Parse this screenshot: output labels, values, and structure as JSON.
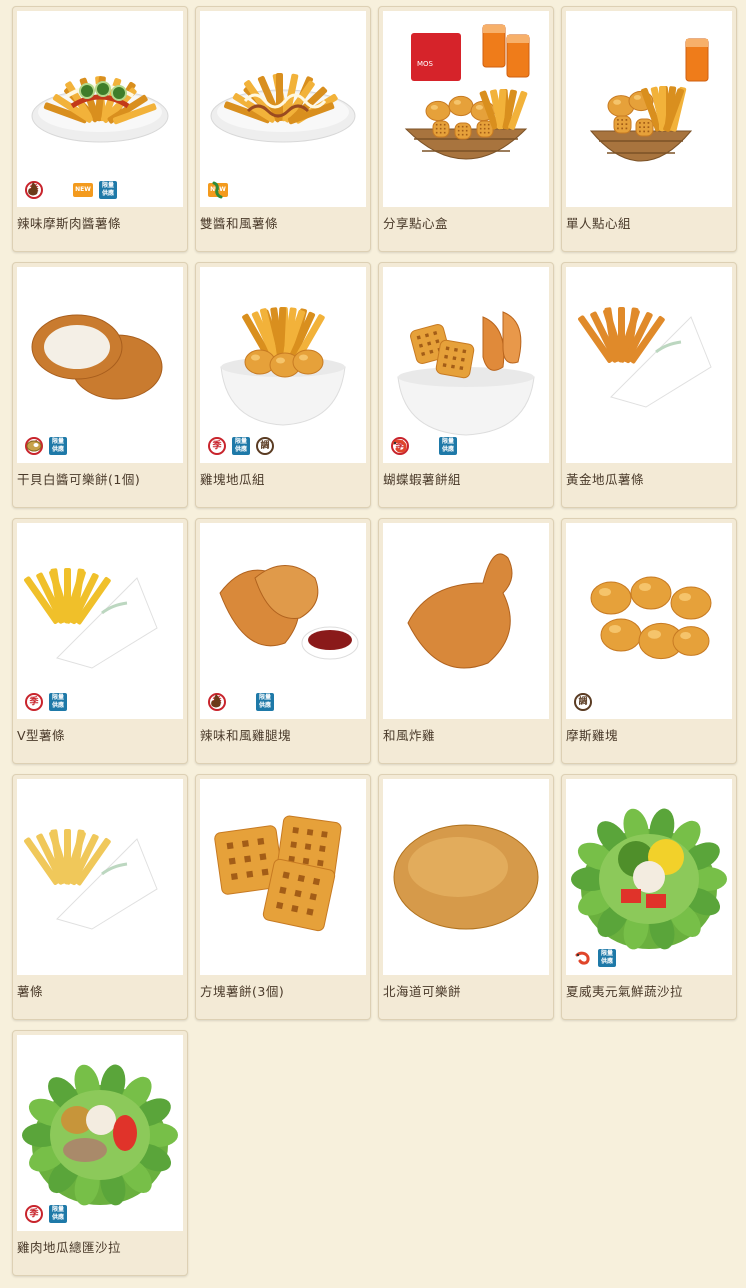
{
  "badge_text": {
    "season": "季",
    "new": "NEW",
    "limited_top": "限量",
    "limited_bottom": "供應",
    "tune": "調"
  },
  "products": [
    {
      "name": "辣味摩斯肉醬薯條",
      "badges": [
        "season",
        "spicy",
        "new",
        "limited"
      ],
      "image": "fries-bowl-meat-sauce-jalapeno"
    },
    {
      "name": "雙醬和風薯條",
      "badges": [
        "new",
        "wasabi"
      ],
      "image": "fries-bowl-two-sauces"
    },
    {
      "name": "分享點心盒",
      "badges": [],
      "image": "share-snack-box-basket-drinks"
    },
    {
      "name": "單人點心組",
      "badges": [],
      "image": "single-snack-set-basket-drink"
    },
    {
      "name": "干貝白醬可樂餅(1個)",
      "badges": [
        "season",
        "limited",
        "potato"
      ],
      "image": "scallop-croquette"
    },
    {
      "name": "雞塊地瓜組",
      "badges": [
        "season",
        "limited",
        "tune"
      ],
      "image": "nuggets-sweet-potato-bowl"
    },
    {
      "name": "蝴蝶蝦薯餅組",
      "badges": [
        "season",
        "shrimp",
        "limited"
      ],
      "image": "butterfly-shrimp-hashbrown-bowl"
    },
    {
      "name": "黃金地瓜薯條",
      "badges": [],
      "image": "sweet-potato-fries-bag"
    },
    {
      "name": "V型薯條",
      "badges": [
        "season",
        "limited"
      ],
      "image": "v-cut-fries-bag"
    },
    {
      "name": "辣味和風雞腿塊",
      "badges": [
        "season",
        "spicy",
        "limited"
      ],
      "image": "spicy-chicken-thigh-sauce"
    },
    {
      "name": "和風炸雞",
      "badges": [],
      "image": "japanese-fried-chicken"
    },
    {
      "name": "摩斯雞塊",
      "badges": [
        "tune"
      ],
      "image": "chicken-nuggets"
    },
    {
      "name": "薯條",
      "badges": [],
      "image": "fries-bag"
    },
    {
      "name": "方塊薯餅(3個)",
      "badges": [],
      "image": "square-hashbrowns"
    },
    {
      "name": "北海道可樂餅",
      "badges": [],
      "image": "hokkaido-croquette"
    },
    {
      "name": "夏威夷元氣鮮蔬沙拉",
      "badges": [
        "shrimp",
        "limited"
      ],
      "image": "hawaiian-salad"
    },
    {
      "name": "雞肉地瓜總匯沙拉",
      "badges": [
        "season",
        "limited"
      ],
      "image": "chicken-sweet-potato-salad"
    }
  ]
}
